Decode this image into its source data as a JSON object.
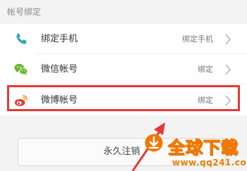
{
  "section": {
    "title": "帐号绑定"
  },
  "rows": [
    {
      "label": "绑定手机",
      "value": "绑定手机",
      "icon": "phone-icon",
      "icon_color": "#3aa8b6"
    },
    {
      "label": "微信帐号",
      "value": "绑定",
      "icon": "wechat-icon",
      "icon_color": "#6bb82f"
    },
    {
      "label": "微博帐号",
      "value": "绑定",
      "icon": "weibo-icon",
      "icon_color": "#e2403a"
    }
  ],
  "permanent_button": {
    "label": "永久注销"
  },
  "watermark": {
    "brand": "全球下载",
    "url": "www.qq241.com"
  },
  "colors": {
    "highlight": "#e53935",
    "watermark": "#f07800"
  }
}
